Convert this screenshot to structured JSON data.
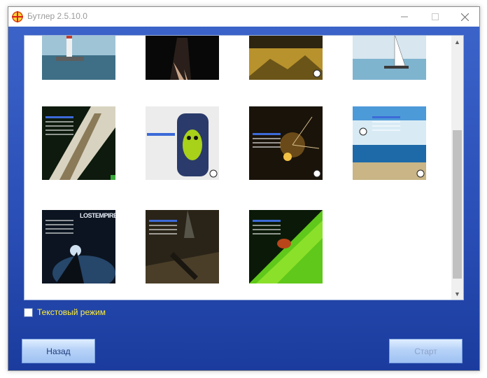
{
  "window": {
    "title": "Бутлер 2.5.10.0",
    "minimize_icon": "minimize-icon",
    "maximize_icon": "maximize-icon",
    "close_icon": "close-icon"
  },
  "thumbnails": [
    {
      "name": "thumb-lighthouse",
      "theme": "lighthouse-sea"
    },
    {
      "name": "thumb-dark-figure",
      "theme": "dark-figure"
    },
    {
      "name": "thumb-golden-landscape",
      "theme": "golden-landscape"
    },
    {
      "name": "thumb-sailboat",
      "theme": "sailboat-sea"
    },
    {
      "name": "thumb-tree-bark",
      "theme": "tree-bark"
    },
    {
      "name": "thumb-green-robot",
      "theme": "green-robot-jar"
    },
    {
      "name": "thumb-spark-dark",
      "theme": "spark-dark"
    },
    {
      "name": "thumb-beach-sky",
      "theme": "beach-sky"
    },
    {
      "name": "thumb-lost-empire",
      "theme": "lost-empire"
    },
    {
      "name": "thumb-soldier",
      "theme": "soldier-smoke"
    },
    {
      "name": "thumb-bug-leaf",
      "theme": "bug-leaf"
    }
  ],
  "lost_empire_text": "LOSTEMPIRE",
  "text_mode_label": "Текстовый режим",
  "text_mode_checked": false,
  "buttons": {
    "back": "Назад",
    "start": "Старт"
  },
  "colors": {
    "background_top": "#3b63c8",
    "background_bottom": "#1b3c9e",
    "checkbox_label": "#ffef3a"
  }
}
